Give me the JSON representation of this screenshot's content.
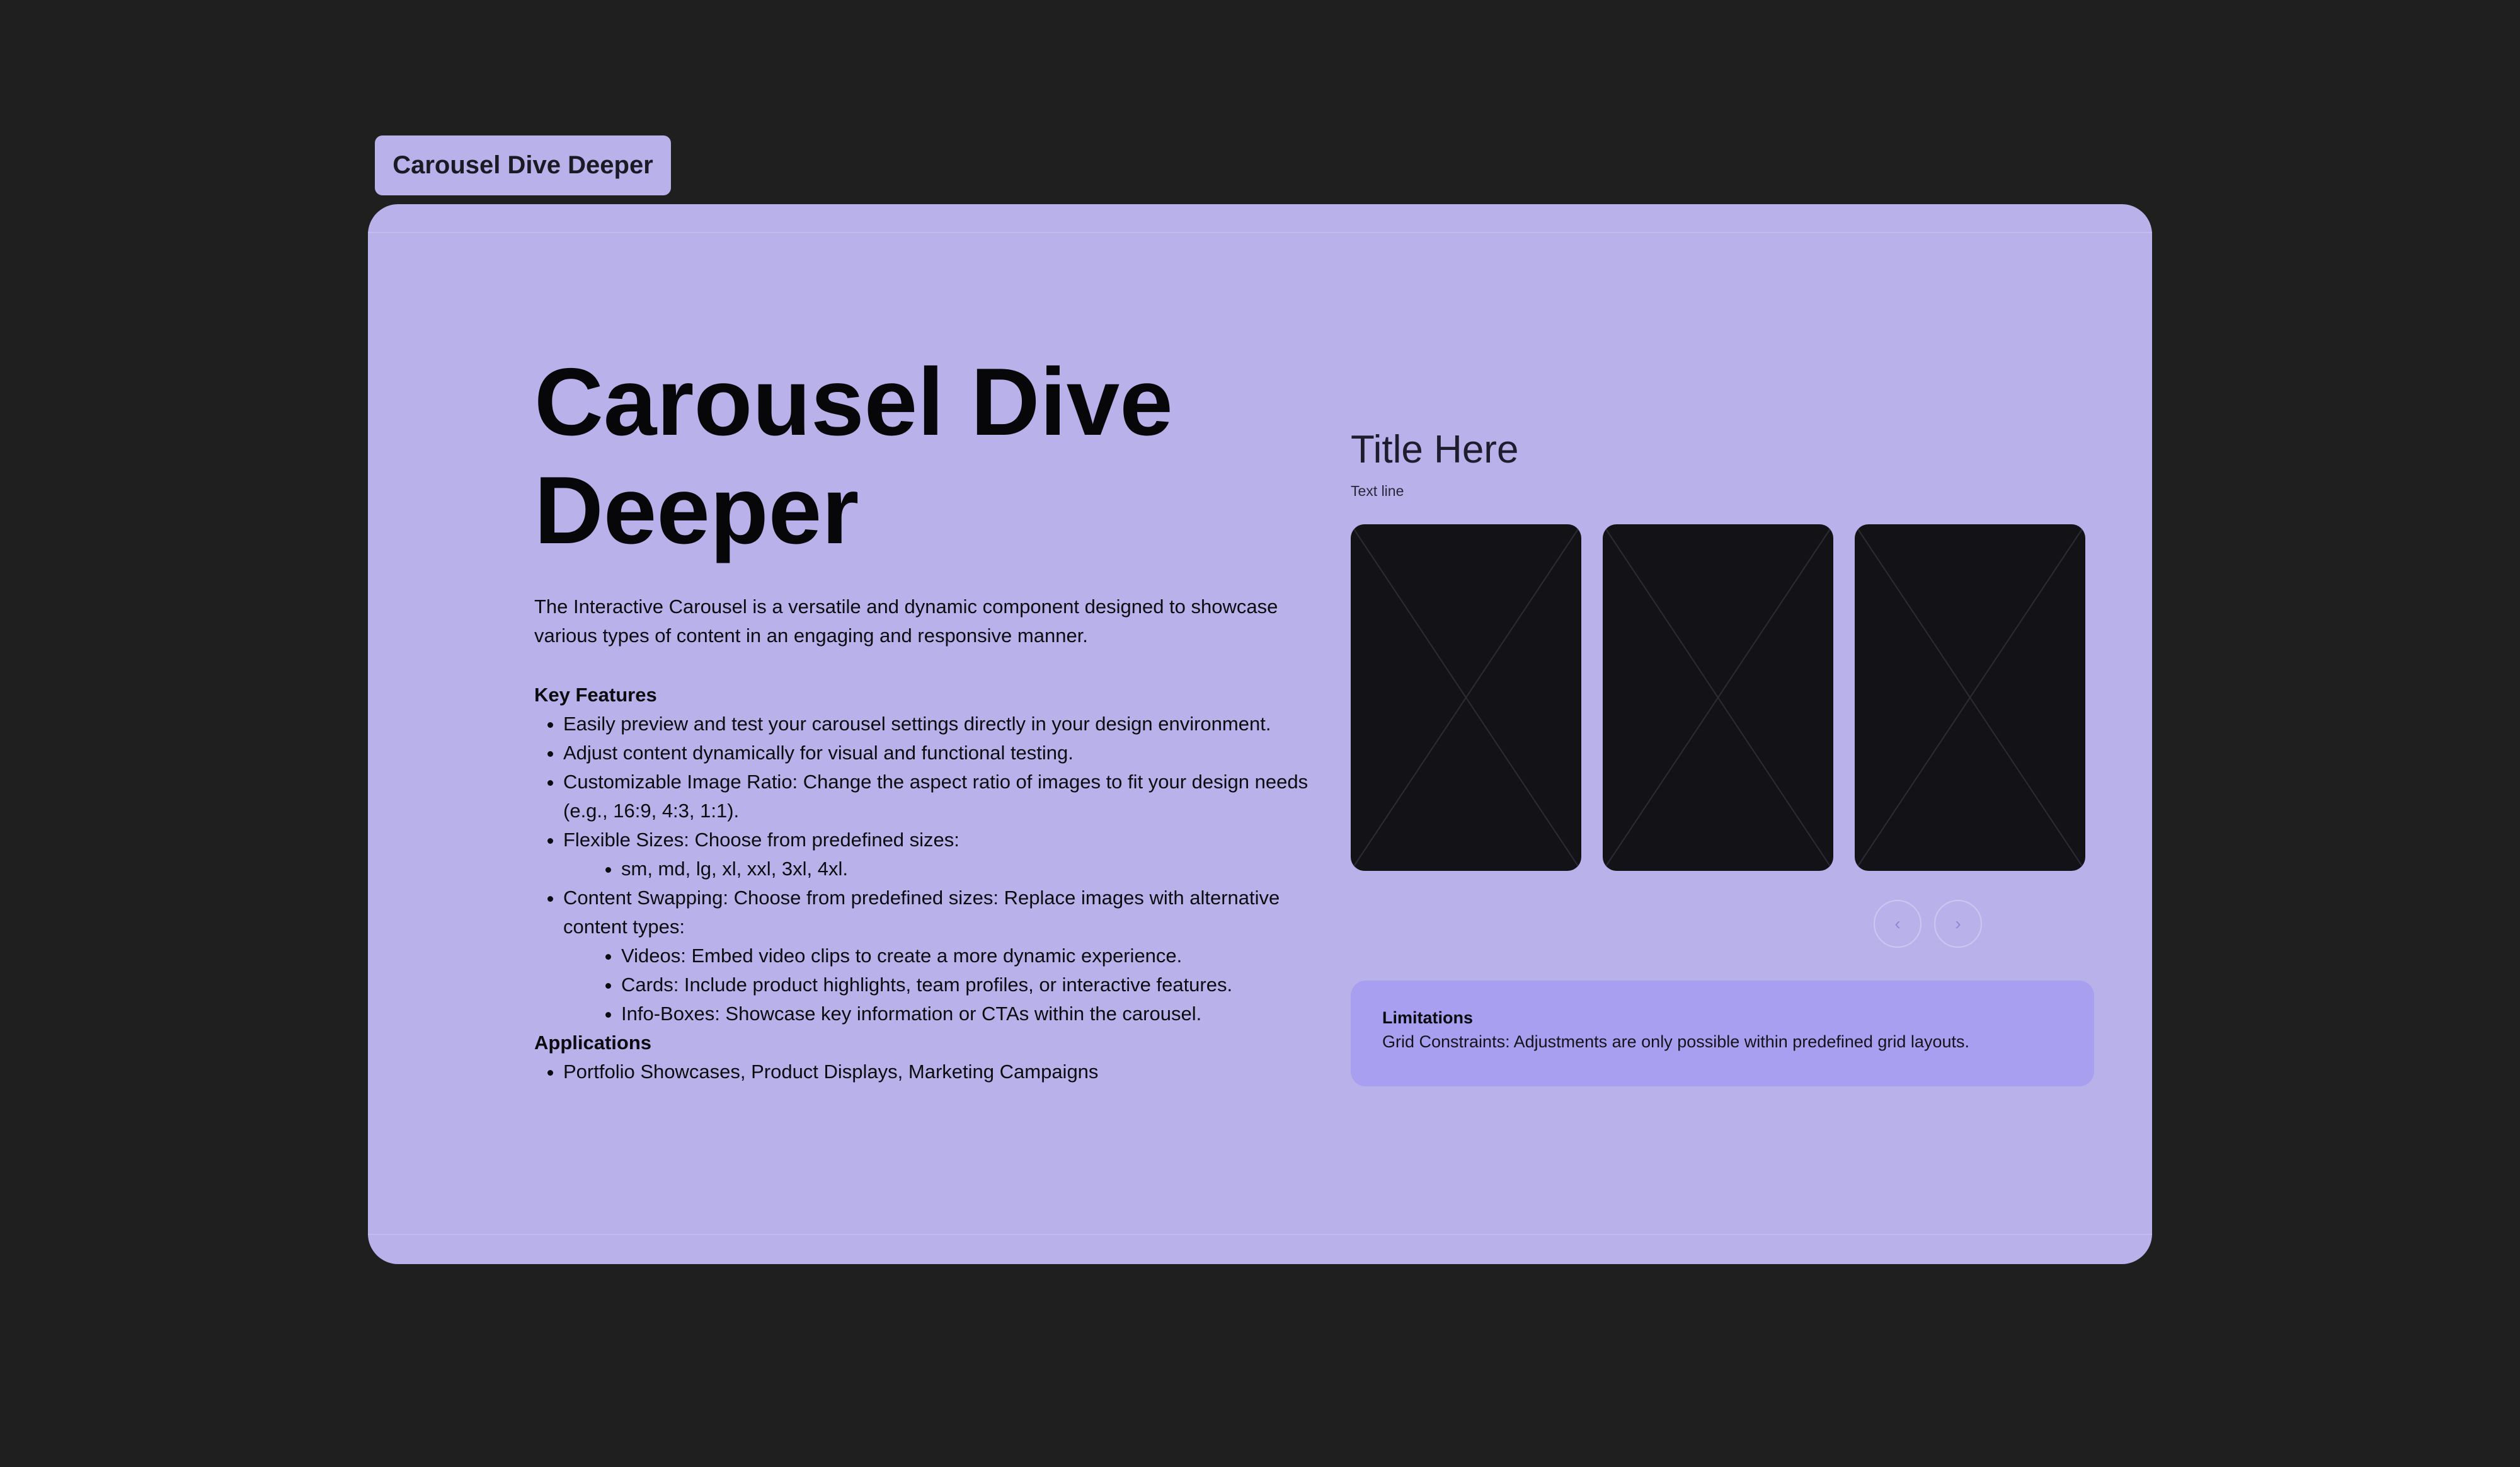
{
  "frame": {
    "tab_label": "Carousel Dive Deeper"
  },
  "hero": {
    "title": "Carousel Dive Deeper",
    "description": "The Interactive Carousel is a versatile and dynamic component designed to showcase various types of content in an engaging and responsive manner."
  },
  "features": {
    "heading": "Key Features",
    "items": [
      "Easily preview and test your carousel settings directly in your design environment.",
      "Adjust content dynamically for visual and functional testing.",
      "Customizable Image Ratio: Change the aspect ratio of images to fit your design needs (e.g., 16:9, 4:3, 1:1).",
      "Flexible Sizes: Choose from predefined sizes:",
      "sm, md, lg, xl, xxl, 3xl, 4xl.",
      "Content Swapping: Choose from predefined sizes: Replace images with alternative content types:",
      "Videos: Embed video clips to create a more dynamic experience.",
      "Cards: Include product highlights, team profiles, or interactive features.",
      "Info-Boxes: Showcase key information or CTAs within the carousel."
    ],
    "applications_heading": "Applications",
    "applications": [
      "Portfolio Showcases, Product Displays, Marketing Campaigns"
    ]
  },
  "carousel": {
    "title": "Title Here",
    "subtitle": "Text line",
    "slide_icon": "image-placeholder-icon",
    "prev_icon": "chevron-left-icon",
    "next_icon": "chevron-right-icon",
    "prev_glyph": "‹",
    "next_glyph": "›"
  },
  "limitations": {
    "heading": "Limitations",
    "text": "Grid Constraints: Adjustments are only possible within predefined grid layouts."
  },
  "colors": {
    "background": "#1f1f1f",
    "panel": "#b9b1ea",
    "callout": "#a89ff0",
    "slide": "#131317",
    "text": "#07070a"
  }
}
